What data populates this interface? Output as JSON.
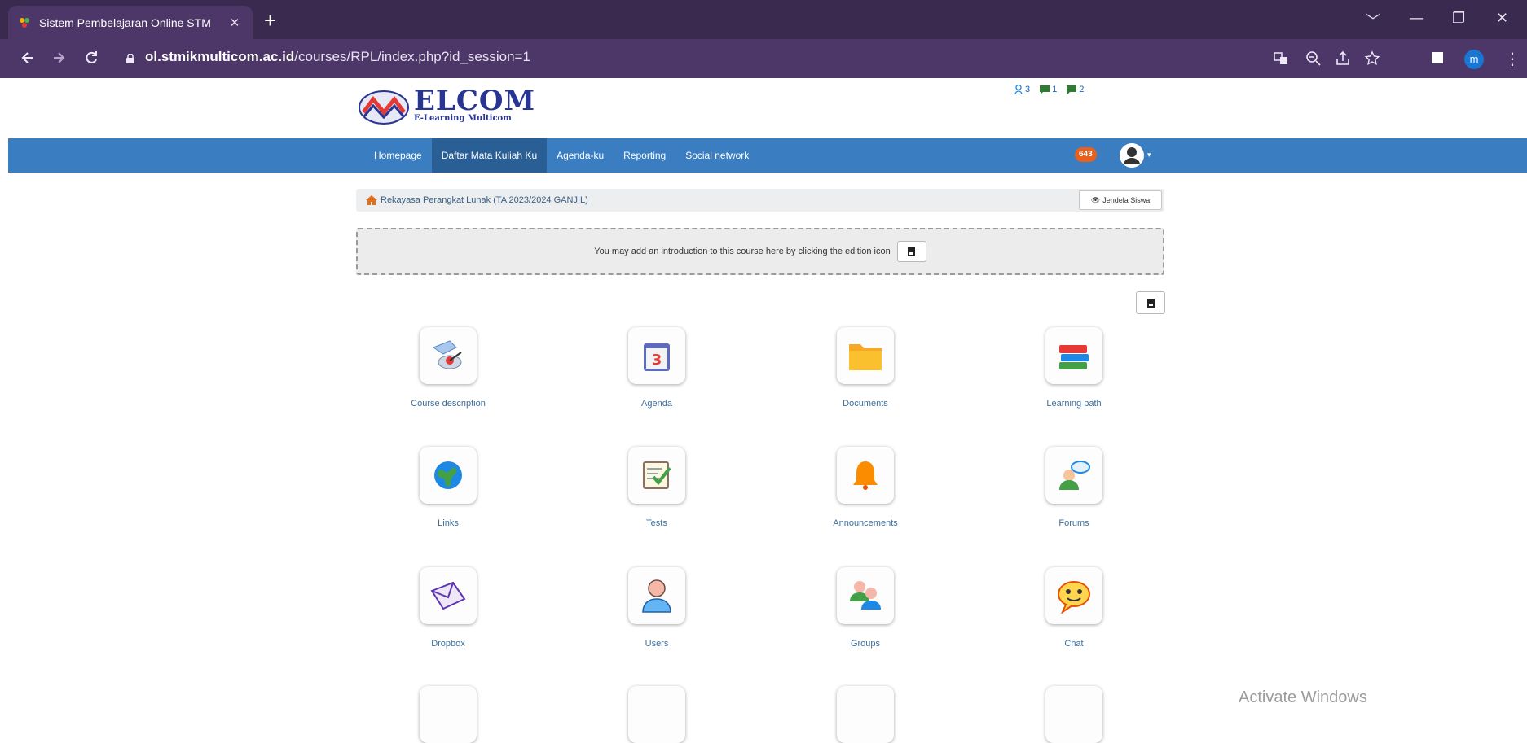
{
  "browser": {
    "tab_title": "Sistem Pembelajaran Online STM",
    "tab_close": "✕",
    "new_tab": "+",
    "url_host": "ol.stmikmulticom.ac.id",
    "url_path": "/courses/RPL/index.php?id_session=1",
    "profile_initial": "m",
    "controls": {
      "collapse": "﹀",
      "minimize": "—",
      "maximize": "❐",
      "close": "✕"
    }
  },
  "site": {
    "logo_title": "ELCOM",
    "logo_subtitle": "E-Learning Multicom",
    "stats": {
      "users": "3",
      "chats": "1",
      "messages": "2"
    },
    "nav": [
      "Homepage",
      "Daftar Mata Kuliah Ku",
      "Agenda-ku",
      "Reporting",
      "Social network"
    ],
    "active_nav": "Daftar Mata Kuliah Ku",
    "notification_count": "643"
  },
  "course": {
    "breadcrumb": "Rekayasa Perangkat Lunak (TA 2023/2024 GANJIL)",
    "student_view": "Jendela Siswa",
    "intro_text": "You may add an introduction to this course here by clicking the edition icon"
  },
  "tools": [
    {
      "label": "Course description",
      "icon": "course-description-icon"
    },
    {
      "label": "Agenda",
      "icon": "agenda-icon"
    },
    {
      "label": "Documents",
      "icon": "documents-icon"
    },
    {
      "label": "Learning path",
      "icon": "learning-path-icon"
    },
    {
      "label": "Links",
      "icon": "links-icon"
    },
    {
      "label": "Tests",
      "icon": "tests-icon"
    },
    {
      "label": "Announcements",
      "icon": "announcements-icon"
    },
    {
      "label": "Forums",
      "icon": "forums-icon"
    },
    {
      "label": "Dropbox",
      "icon": "dropbox-icon"
    },
    {
      "label": "Users",
      "icon": "users-icon"
    },
    {
      "label": "Groups",
      "icon": "groups-icon"
    },
    {
      "label": "Chat",
      "icon": "chat-icon"
    }
  ],
  "watermark": "Activate Windows",
  "colors": {
    "tabbar": "#3b2a4f",
    "addressbar": "#4d3668",
    "navbar": "#3a7dc0",
    "navbar_active": "#2a5f96",
    "badge": "#e8601c",
    "link": "#3b6e9c"
  }
}
